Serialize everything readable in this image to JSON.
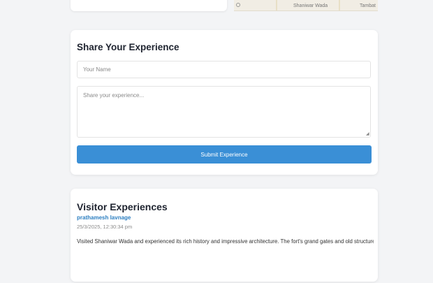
{
  "top_map": {
    "label_center": "Shaniwar Wada",
    "label_right": "Tambat"
  },
  "share": {
    "title": "Share Your Experience",
    "name_placeholder": "Your Name",
    "experience_placeholder": "Share your experience...",
    "submit_label": "Submit Experience"
  },
  "visitors": {
    "title": "Visitor Experiences",
    "entries": [
      {
        "author": "prathamesh lavnage",
        "date": "25/3/2025, 12:30:34 pm",
        "text": "Visited Shaniwar Wada and experienced its rich history and impressive architecture. The fort's grand gates and old structures made the visit memorable."
      }
    ]
  },
  "colors": {
    "accent": "#3a8fd6",
    "author": "#2d7fc1",
    "background": "#f3f4f6"
  }
}
